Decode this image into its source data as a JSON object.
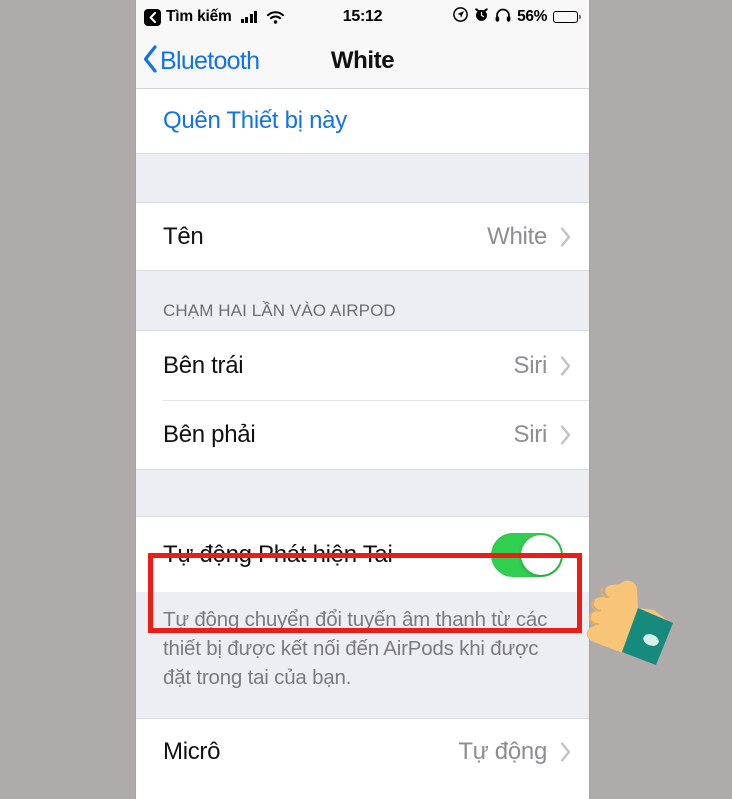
{
  "statusbar": {
    "back_badge_icon": "back-chevron-icon",
    "back_label": "Tìm kiếm",
    "signal_icon": "cellular-signal-icon",
    "wifi_icon": "wifi-icon",
    "time": "15:12",
    "location_icon": "location-arrow-icon",
    "alarm_icon": "alarm-clock-icon",
    "headphones_icon": "headphones-icon",
    "battery_percent": "56%",
    "battery_icon": "battery-icon"
  },
  "navbar": {
    "back_icon": "chevron-left-icon",
    "back_label": "Bluetooth",
    "title": "White"
  },
  "list": {
    "forget_device": "Quên Thiết bị này",
    "name_row": {
      "label": "Tên",
      "value": "White",
      "chevron": "chevron-right-icon"
    },
    "section_header": "CHẠM HAI LẦN VÀO AIRPOD",
    "left_row": {
      "label": "Bên trái",
      "value": "Siri",
      "chevron": "chevron-right-icon"
    },
    "right_row": {
      "label": "Bên phải",
      "value": "Siri",
      "chevron": "chevron-right-icon"
    },
    "ear_detection_row": {
      "label": "Tự động Phát hiện Tai",
      "toggle_state": "on",
      "toggle_color": "#30cf4f"
    },
    "ear_detection_footer": "Tự động chuyển đổi tuyến âm thanh từ các thiết bị được kết nối đến AirPods khi được đặt trong tai của bạn.",
    "mic_row": {
      "label": "Micrô",
      "value": "Tự động",
      "chevron": "chevron-right-icon"
    }
  },
  "annotation": {
    "highlight_color": "#ec1c16",
    "pointer_icon": "pointing-hand-icon",
    "hand_skin_color": "#f8c477",
    "hand_sleeve_color": "#168a7c"
  }
}
